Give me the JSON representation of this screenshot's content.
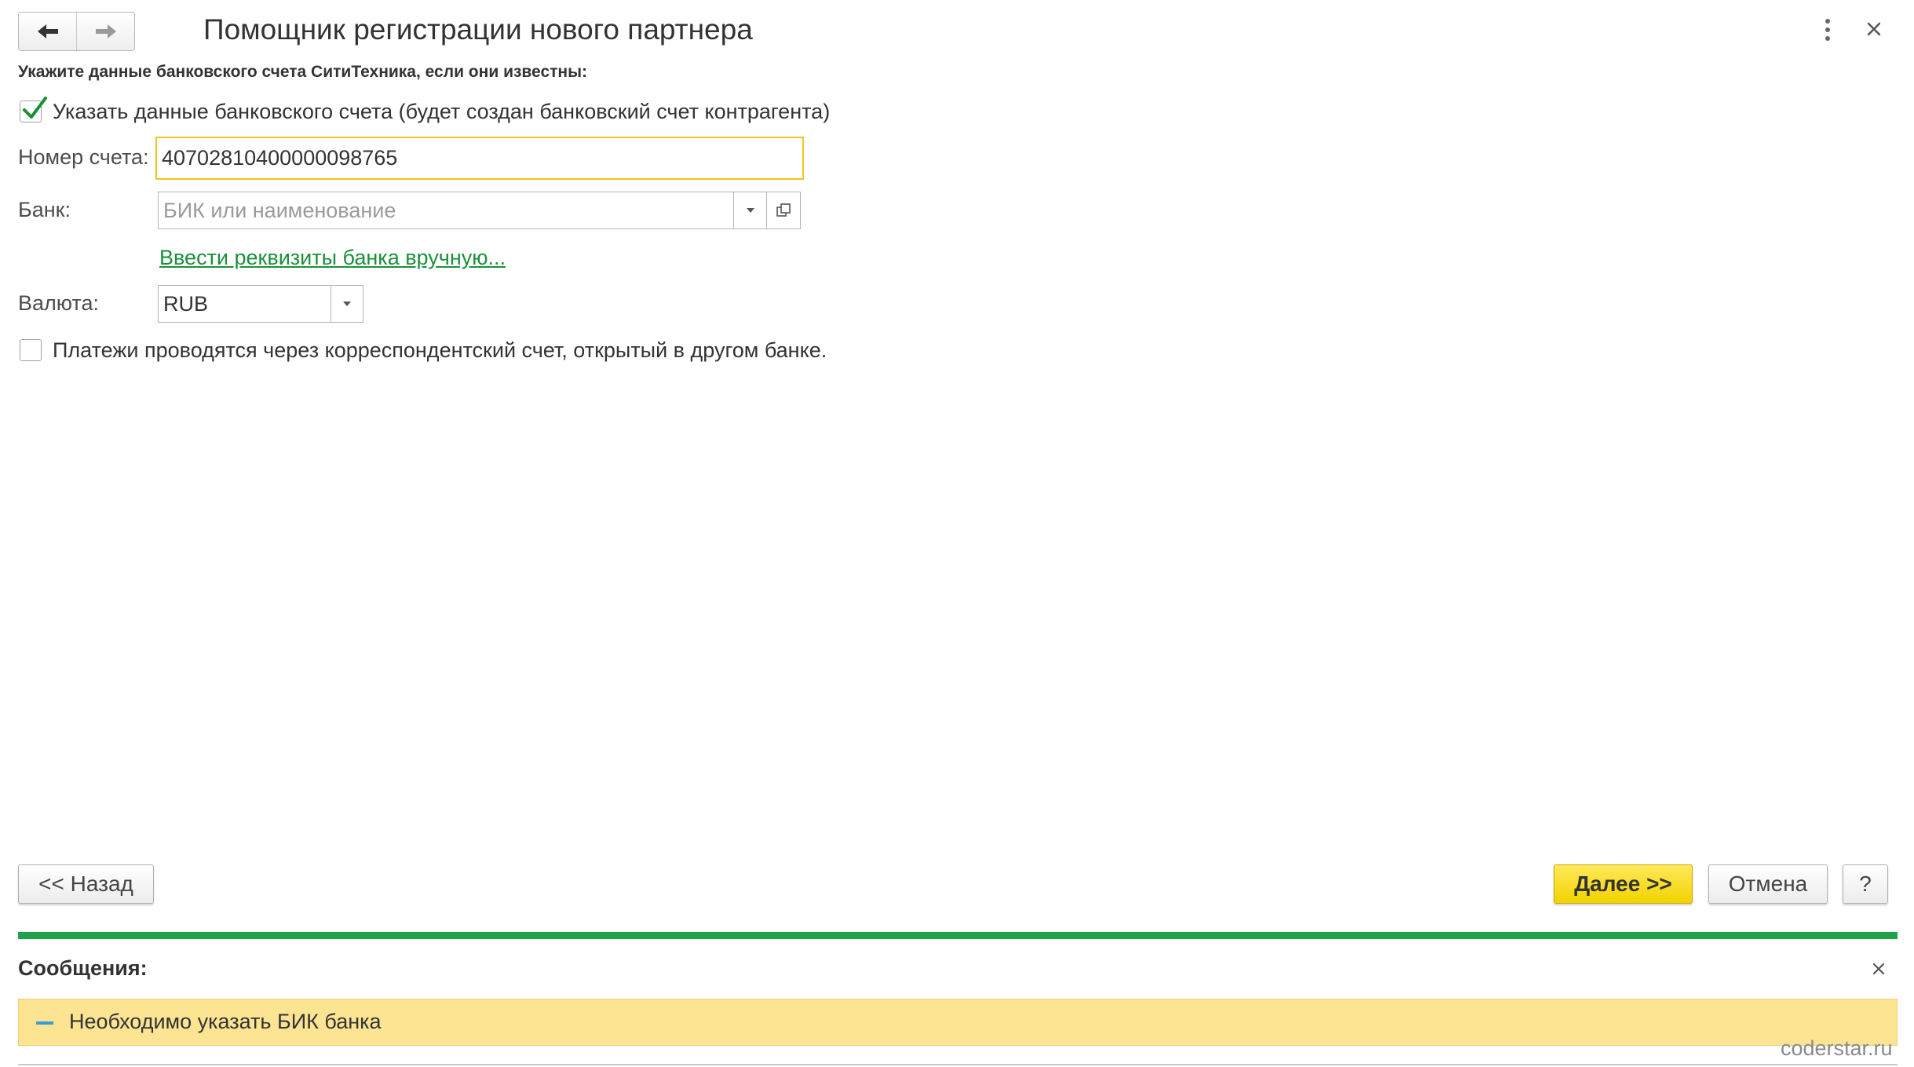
{
  "header": {
    "title": "Помощник регистрации нового партнера",
    "back_icon": "arrow-left-icon",
    "forward_icon": "arrow-right-icon",
    "more_icon": "more-vertical-icon",
    "close_icon": "close-icon"
  },
  "form": {
    "instruction": "Укажите данные банковского счета СитиТехника, если они известны:",
    "specify_bank_account": {
      "label": "Указать данные банковского счета (будет создан банковский счет контрагента)",
      "checked": true
    },
    "account_number": {
      "label": "Номер счета:",
      "value": "40702810400000098765"
    },
    "bank": {
      "label": "Банк:",
      "value": "",
      "placeholder": "БИК или наименование"
    },
    "manual_bank_link": "Ввести реквизиты банка вручную...",
    "currency": {
      "label": "Валюта:",
      "value": "RUB"
    },
    "correspondent_account": {
      "label": "Платежи проводятся через корреспондентский счет, открытый в другом банке.",
      "checked": false
    }
  },
  "footer": {
    "back_label": "<< Назад",
    "next_label": "Далее >>",
    "cancel_label": "Отмена",
    "help_label": "?"
  },
  "messages": {
    "title": "Сообщения:",
    "items": [
      {
        "text": "Необходимо указать БИК банка"
      }
    ]
  },
  "watermark": "coderstar.ru",
  "colors": {
    "accent_green": "#1ba448",
    "link_green": "#1c8f3b",
    "primary_button": "#f5d60a",
    "focus_border": "#f0c419",
    "message_bg": "#fde493"
  }
}
